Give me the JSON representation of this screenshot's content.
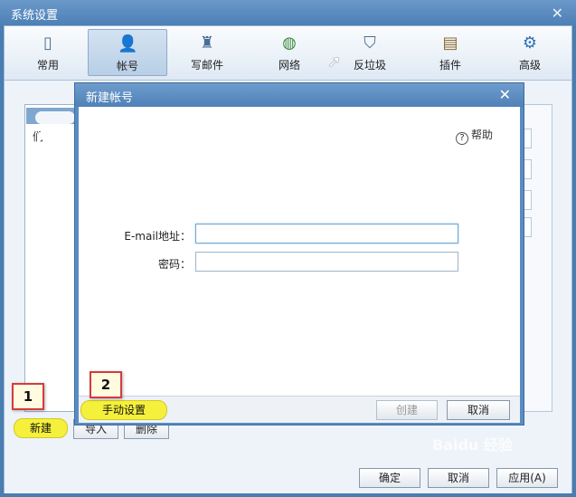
{
  "window": {
    "title": "系统设置"
  },
  "toolbar": {
    "items": [
      {
        "label": "常用",
        "icon": "device-icon"
      },
      {
        "label": "帐号",
        "icon": "user-icon"
      },
      {
        "label": "写邮件",
        "icon": "stamp-icon"
      },
      {
        "label": "网络",
        "icon": "globe-icon"
      },
      {
        "label": "反垃圾",
        "icon": "shield-icon"
      },
      {
        "label": "插件",
        "icon": "box-icon"
      },
      {
        "label": "高级",
        "icon": "gear-icon"
      }
    ],
    "active": "帐号"
  },
  "account_list": {
    "second_row_prefix": "们"
  },
  "background_buttons": {
    "new": "新建",
    "import": "导入",
    "delete": "删除"
  },
  "modal": {
    "title": "新建帐号",
    "help": "帮助",
    "email_label": "E-mail地址：",
    "password_label": "密码：",
    "email_value": "",
    "password_value": "",
    "manual_setup": "手动设置",
    "create": "创建",
    "cancel": "取消"
  },
  "annotations": {
    "step1": "1",
    "step2": "2"
  },
  "bottom": {
    "ok": "确定",
    "cancel": "取消",
    "apply": "应用(A)"
  },
  "watermark": "Baidu 经验",
  "colors": {
    "titlebar": "#4c80b6",
    "highlight": "#f5f03c",
    "annotation_border": "#d33c3c"
  }
}
